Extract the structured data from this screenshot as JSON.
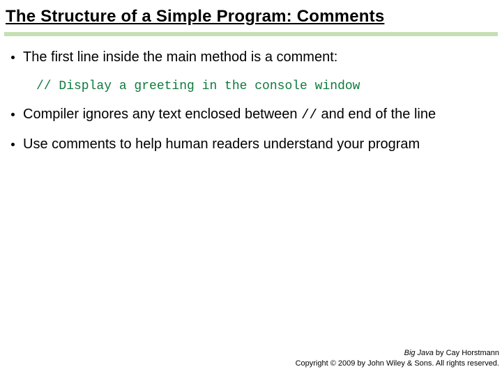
{
  "title": "The Structure of a Simple Program: Comments",
  "bullets": {
    "b1": "The first line inside the main method is a comment:",
    "code": "// Display a greeting in the console window",
    "b2_pre": "Compiler ignores any text enclosed between ",
    "b2_code": "//",
    "b2_post": " and end of the line",
    "b3": "Use comments to help human readers understand your program"
  },
  "footer": {
    "book": "Big Java",
    "byline": " by Cay Horstmann",
    "copyright": "Copyright © 2009 by John Wiley & Sons.  All rights reserved."
  }
}
